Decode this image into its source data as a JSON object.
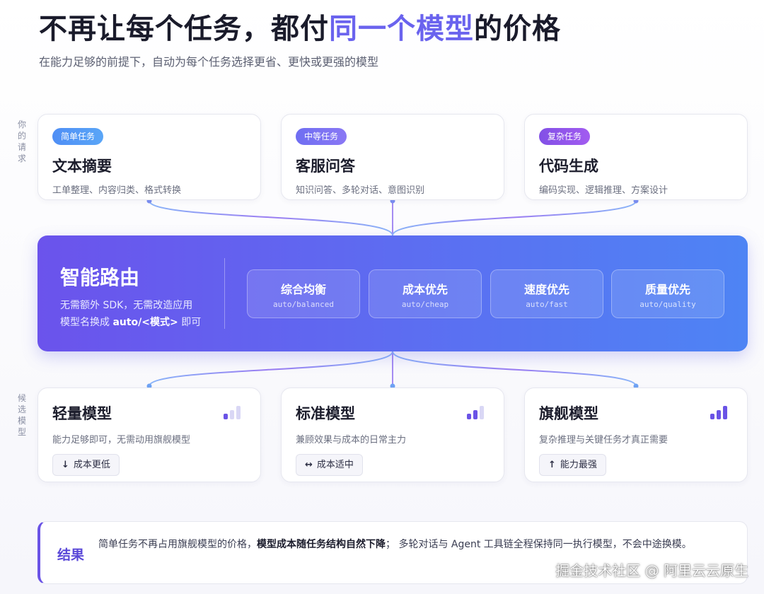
{
  "header": {
    "title_pre": "不再让每个任务，都付",
    "title_highlight": "同一个模型",
    "title_post": "的价格",
    "subtitle": "在能力足够的前提下，自动为每个任务选择更省、更快或更强的模型"
  },
  "side_labels": {
    "requests": "你的请求",
    "candidates": "候选模型"
  },
  "requests": [
    {
      "badge": "简单任务",
      "title": "文本摘要",
      "desc": "工单整理、内容归类、格式转换"
    },
    {
      "badge": "中等任务",
      "title": "客服问答",
      "desc": "知识问答、多轮对话、意图识别"
    },
    {
      "badge": "复杂任务",
      "title": "代码生成",
      "desc": "编码实现、逻辑推理、方案设计"
    }
  ],
  "router": {
    "title": "智能路由",
    "desc_line1": "无需额外 SDK，无需改造应用",
    "desc_line2_pre": "模型名换成 ",
    "desc_line2_bold": "auto/<模式>",
    "desc_line2_post": " 即可",
    "modes": [
      {
        "name": "综合均衡",
        "code": "auto/balanced"
      },
      {
        "name": "成本优先",
        "code": "auto/cheap"
      },
      {
        "name": "速度优先",
        "code": "auto/fast"
      },
      {
        "name": "质量优先",
        "code": "auto/quality"
      }
    ]
  },
  "models": [
    {
      "title": "轻量模型",
      "desc": "能力足够即可，无需动用旗舰模型",
      "tag_arrow": "↓",
      "tag": "成本更低",
      "level": 1
    },
    {
      "title": "标准模型",
      "desc": "兼顾效果与成本的日常主力",
      "tag_arrow": "↔",
      "tag": "成本适中",
      "level": 2
    },
    {
      "title": "旗舰模型",
      "desc": "复杂推理与关键任务才真正需要",
      "tag_arrow": "↑",
      "tag": "能力最强",
      "level": 3
    }
  ],
  "result": {
    "label": "结果",
    "text_pre": "简单任务不再占用旗舰模型的价格，",
    "text_bold": "模型成本随任务结构自然下降",
    "text_post": "； 多轮对话与 Agent 工具链全程保持同一执行模型，不会中途换模。"
  },
  "watermark": "掘金技术社区 @ 阿里云云原生",
  "colors": {
    "accent": "#6a63ee",
    "bar_active": "#6a53e6",
    "bar_inactive": "#d9d7f5"
  }
}
